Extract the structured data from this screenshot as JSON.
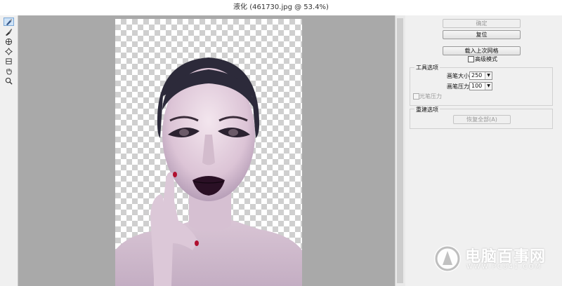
{
  "window": {
    "title": "液化 (461730.jpg @ 53.4%)"
  },
  "tools": [
    {
      "name": "forward-warp-tool-icon",
      "active": true
    },
    {
      "name": "reconstruct-tool-icon",
      "active": false
    },
    {
      "name": "pucker-tool-icon",
      "active": false
    },
    {
      "name": "bloat-tool-icon",
      "active": false
    },
    {
      "name": "push-left-tool-icon",
      "active": false
    },
    {
      "name": "hand-tool-icon",
      "active": false
    },
    {
      "name": "zoom-tool-icon",
      "active": false
    }
  ],
  "panel": {
    "ok_label": "确定",
    "reset_label": "复位",
    "load_mesh_label": "载入上次网格",
    "advanced_mode_label": "高级模式",
    "tool_options": {
      "title": "工具选项",
      "brush_size_label": "画笔大小:",
      "brush_size_value": "250",
      "brush_pressure_label": "画笔压力:",
      "brush_pressure_value": "100",
      "stylus_pressure_label": "光笔压力"
    },
    "reconstruct_options": {
      "title": "重建选项",
      "restore_all_label": "恢复全部(A)"
    }
  },
  "watermark": {
    "text": "电脑百事网",
    "sub": "WWW.PC841.COM"
  },
  "colors": {
    "canvas_bg": "#a9a9a9",
    "panel_bg": "#f0f0f0",
    "skin": "#e9d9e4",
    "hair": "#2c2a3a",
    "lips": "#2a1025"
  }
}
